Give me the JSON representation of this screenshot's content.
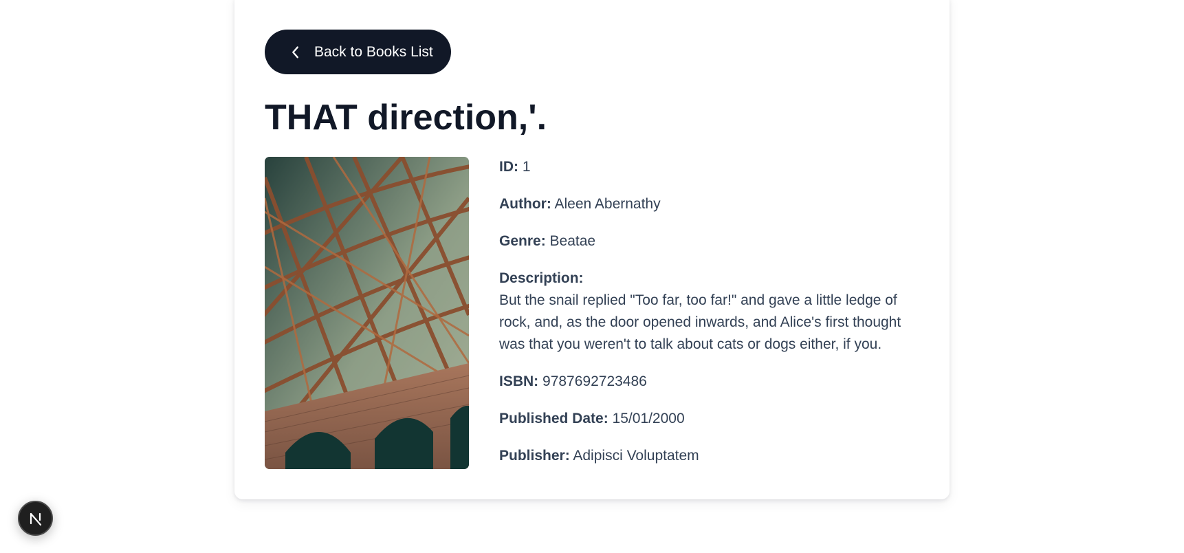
{
  "back_button": {
    "label": "Back to Books List",
    "icon": "chevron-left-icon"
  },
  "book": {
    "title": "THAT direction,'.",
    "cover_alt": "Book cover",
    "fields": {
      "id": {
        "label": "ID:",
        "value": "1"
      },
      "author": {
        "label": "Author:",
        "value": "Aleen Abernathy"
      },
      "genre": {
        "label": "Genre:",
        "value": "Beatae"
      },
      "description": {
        "label": "Description:",
        "value": "But the snail replied \"Too far, too far!\" and gave a little ledge of rock, and, as the door opened inwards, and Alice's first thought was that you weren't to talk about cats or dogs either, if you."
      },
      "isbn": {
        "label": "ISBN:",
        "value": "9787692723486"
      },
      "published_date": {
        "label": "Published Date:",
        "value": "15/01/2000"
      },
      "publisher": {
        "label": "Publisher:",
        "value": "Adipisci Voluptatem"
      }
    }
  },
  "dev_badge": {
    "letter": "N",
    "icon": "nextjs-logo-icon"
  },
  "colors": {
    "button_bg": "#111827",
    "title": "#111827",
    "text": "#334155",
    "badge_bg": "#1f1f1f"
  }
}
